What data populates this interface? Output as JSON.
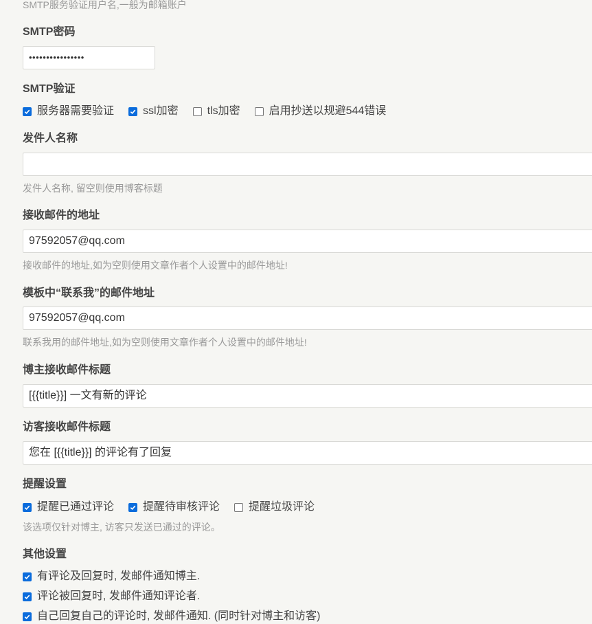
{
  "smtp_user": {
    "desc": "SMTP服务验证用户名,一般为邮箱账户"
  },
  "smtp_password": {
    "label": "SMTP密码",
    "value": "••••••••••••••••"
  },
  "smtp_auth": {
    "label": "SMTP验证",
    "options": [
      {
        "label": "服务器需要验证",
        "checked": true
      },
      {
        "label": "ssl加密",
        "checked": true
      },
      {
        "label": "tls加密",
        "checked": false
      },
      {
        "label": "启用抄送以规避544错误",
        "checked": false
      }
    ]
  },
  "sender_name": {
    "label": "发件人名称",
    "value": "",
    "desc": "发件人名称, 留空则使用博客标题"
  },
  "receive_address": {
    "label": "接收邮件的地址",
    "value": "97592057@qq.com",
    "desc": "接收邮件的地址,如为空则使用文章作者个人设置中的邮件地址!"
  },
  "contact_address": {
    "label": "模板中“联系我”的邮件地址",
    "value": "97592057@qq.com",
    "desc": "联系我用的邮件地址,如为空则使用文章作者个人设置中的邮件地址!"
  },
  "owner_subject": {
    "label": "博主接收邮件标题",
    "value": "[{{title}}] 一文有新的评论"
  },
  "visitor_subject": {
    "label": "访客接收邮件标题",
    "value": "您在 [{{title}}] 的评论有了回复"
  },
  "reminder": {
    "label": "提醒设置",
    "options": [
      {
        "label": "提醒已通过评论",
        "checked": true
      },
      {
        "label": "提醒待审核评论",
        "checked": true
      },
      {
        "label": "提醒垃圾评论",
        "checked": false
      }
    ],
    "desc": "该选项仅针对博主, 访客只发送已通过的评论。"
  },
  "other": {
    "label": "其他设置",
    "options": [
      {
        "label": "有评论及回复时, 发邮件通知博主.",
        "checked": true
      },
      {
        "label": "评论被回复时, 发邮件通知评论者.",
        "checked": true
      },
      {
        "label": "自己回复自己的评论时, 发邮件通知. (同时针对博主和访客)",
        "checked": true
      }
    ]
  },
  "colors": {
    "accent": "#0b6cdc",
    "background": "#f6f6f3",
    "label": "#444444",
    "hint": "#999999"
  }
}
